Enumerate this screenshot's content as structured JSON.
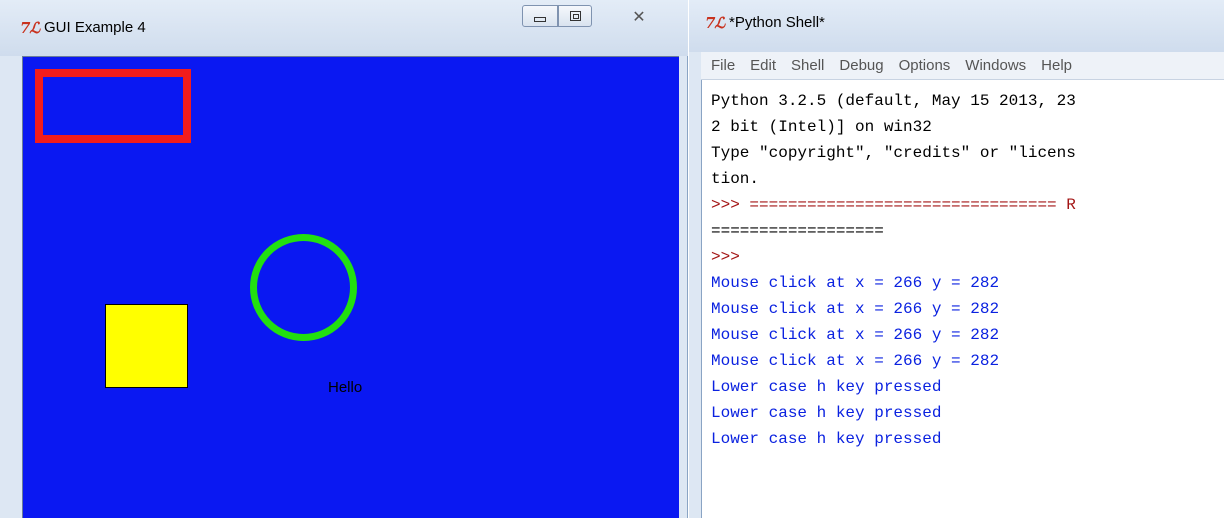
{
  "left_window": {
    "title": "GUI Example 4",
    "tk_icon": "7ℒ",
    "controls": {
      "minimize_icon": "minimize-icon",
      "maximize_icon": "maximize-icon",
      "close_glyph": "✕"
    },
    "canvas": {
      "background": "#0a18f2",
      "shapes": {
        "red_rectangle_color": "#f21c1c",
        "green_circle_color": "#22e010",
        "yellow_square_color": "#ffff00"
      },
      "label_text": "Hello"
    }
  },
  "right_window": {
    "title": "*Python Shell*",
    "tk_icon": "7ℒ",
    "menu": [
      "File",
      "Edit",
      "Shell",
      "Debug",
      "Options",
      "Windows",
      "Help"
    ],
    "shell_lines": [
      {
        "kind": "out",
        "text": "Python 3.2.5 (default, May 15 2013, 23"
      },
      {
        "kind": "out",
        "text": "2 bit (Intel)] on win32"
      },
      {
        "kind": "out",
        "text": "Type \"copyright\", \"credits\" or \"licens"
      },
      {
        "kind": "out",
        "text": "tion."
      },
      {
        "kind": "prompt",
        "text": ">>> ================================ R"
      },
      {
        "kind": "out",
        "text": "=================="
      },
      {
        "kind": "prompt",
        "text": ">>>"
      },
      {
        "kind": "stdout",
        "text": "Mouse click at x = 266 y = 282"
      },
      {
        "kind": "stdout",
        "text": "Mouse click at x = 266 y = 282"
      },
      {
        "kind": "stdout",
        "text": "Mouse click at x = 266 y = 282"
      },
      {
        "kind": "stdout",
        "text": "Mouse click at x = 266 y = 282"
      },
      {
        "kind": "stdout",
        "text": "Lower case h key pressed"
      },
      {
        "kind": "stdout",
        "text": "Lower case h key pressed"
      },
      {
        "kind": "stdout",
        "text": "Lower case h key pressed"
      }
    ]
  }
}
